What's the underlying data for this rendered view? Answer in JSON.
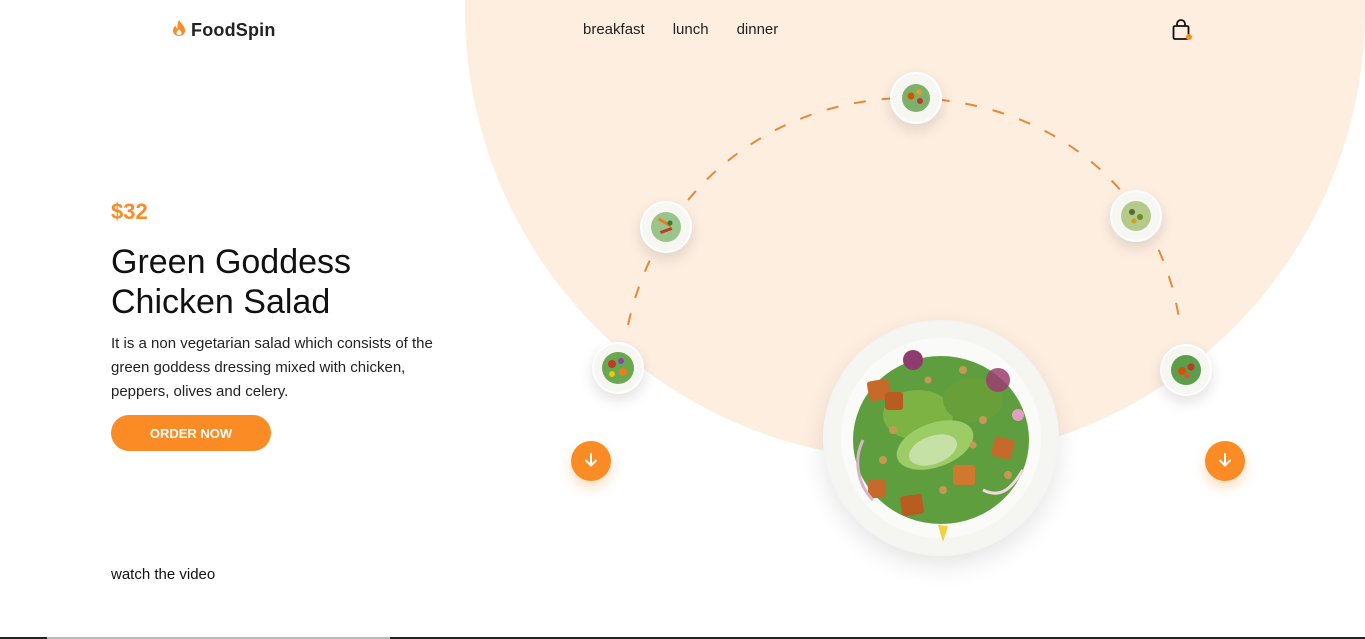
{
  "brand": {
    "name": "FoodSpin",
    "icon": "flame-icon",
    "accent": "#fb8b24"
  },
  "nav": {
    "items": [
      "breakfast",
      "lunch",
      "dinner"
    ]
  },
  "cart": {
    "icon": "shopping-bag-icon"
  },
  "product": {
    "price": "$32",
    "title": "Green Goddess Chicken Salad",
    "description": "It is a non vegetarian salad which consists of the green goddess dressing mixed with chicken, peppers, olives and celery.",
    "cta": "ORDER NOW"
  },
  "video": {
    "label": "watch the video"
  },
  "carousel": {
    "prev_icon": "arrow-down-icon",
    "next_icon": "arrow-down-icon",
    "background": "#fdeee0"
  }
}
